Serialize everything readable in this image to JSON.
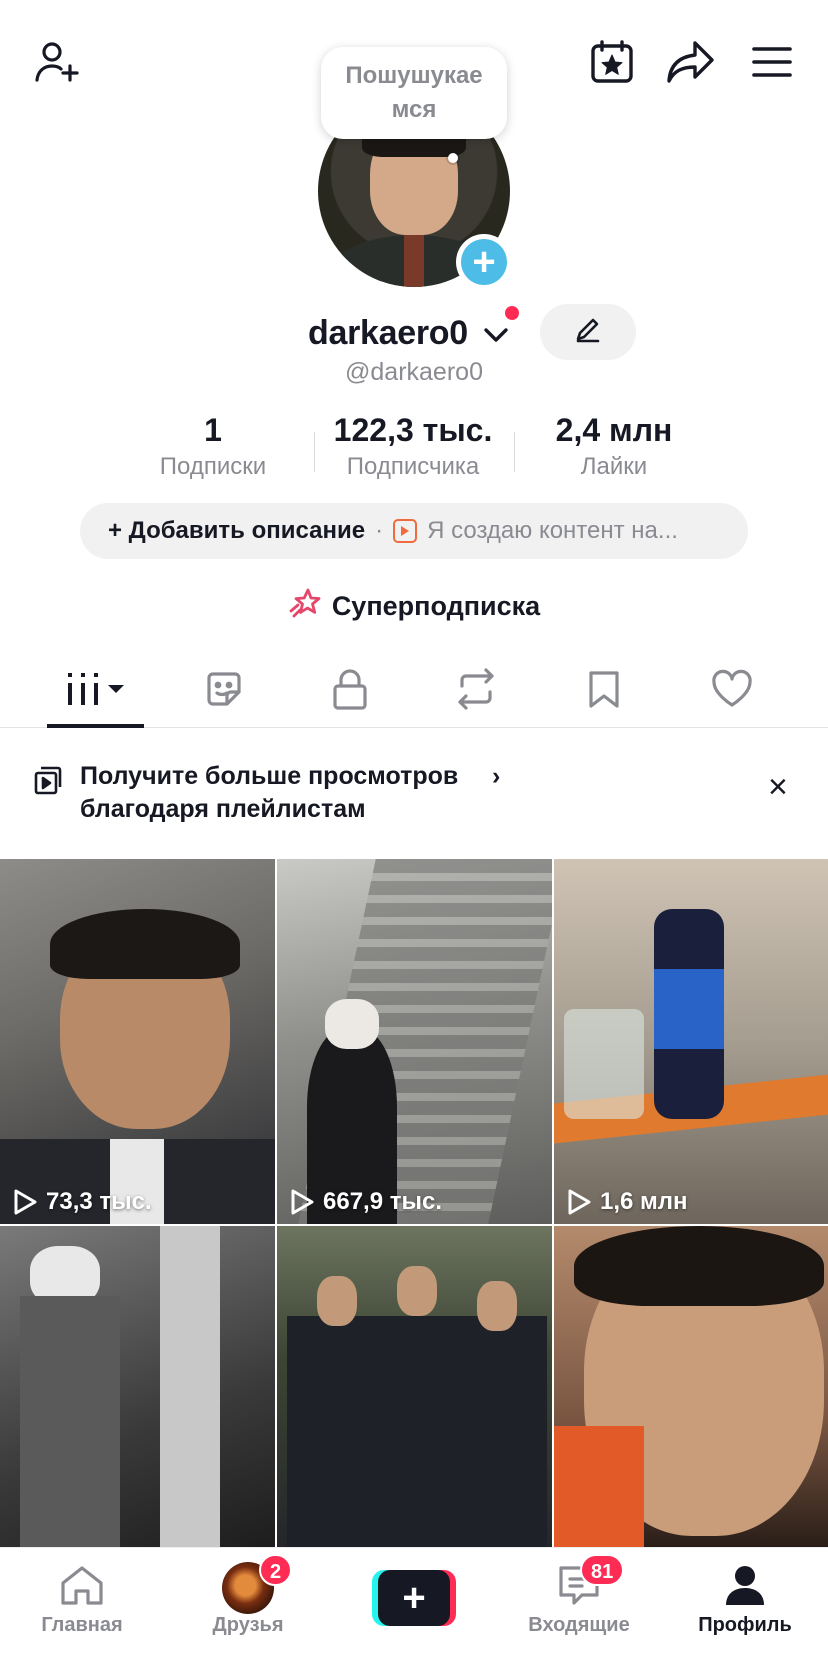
{
  "header": {
    "add_friend_icon": "person-plus-icon",
    "calendar_icon": "calendar-star-icon",
    "share_icon": "share-arrow-icon",
    "menu_icon": "hamburger-menu-icon"
  },
  "profile": {
    "status_bubble": "Пошушукаемся",
    "username": "darkaero0",
    "handle": "@darkaero0",
    "stats": [
      {
        "value": "1",
        "label": "Подписки"
      },
      {
        "value": "122,3 тыс.",
        "label": "Подписчика"
      },
      {
        "value": "2,4 млн",
        "label": "Лайки"
      }
    ],
    "add_description": "+ Добавить описание",
    "separator": "·",
    "creator_text": "Я создаю контент на...",
    "super_subscription": "Суперподписка"
  },
  "tabs": [
    {
      "name": "videos",
      "icon": "grid-bars-icon",
      "active": true
    },
    {
      "name": "stickers",
      "icon": "sticker-icon"
    },
    {
      "name": "private",
      "icon": "lock-icon"
    },
    {
      "name": "reposts",
      "icon": "repost-icon"
    },
    {
      "name": "favorites",
      "icon": "bookmark-icon"
    },
    {
      "name": "liked",
      "icon": "heart-icon"
    }
  ],
  "promo": {
    "text": "Получите больше просмотров благодаря плейлистам",
    "arrow": "›",
    "close": "×"
  },
  "videos": [
    {
      "views": "73,3 тыс."
    },
    {
      "views": "667,9 тыс."
    },
    {
      "views": "1,6 млн"
    },
    {
      "views": ""
    },
    {
      "views": ""
    },
    {
      "views": ""
    }
  ],
  "bottom_nav": {
    "home": "Главная",
    "friends": "Друзья",
    "friends_badge": "2",
    "inbox": "Входящие",
    "inbox_badge": "81",
    "profile": "Профиль",
    "create": "+"
  },
  "colors": {
    "accent_red": "#fe2c55",
    "accent_cyan": "#25f4ee",
    "avatar_plus_blue": "#4dbde8",
    "muted_text": "#8a8b91"
  }
}
